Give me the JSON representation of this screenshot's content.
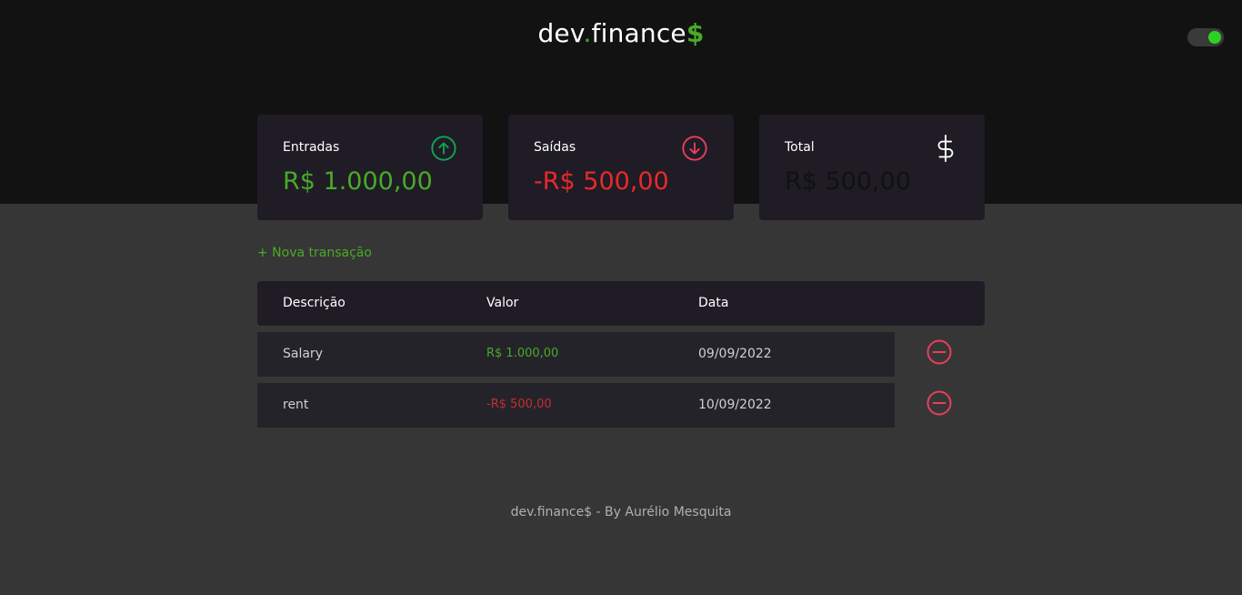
{
  "header": {
    "logo_main": "dev",
    "logo_dot": ".",
    "logo_word": "finance",
    "logo_dollar": "$",
    "theme_toggle_on": true
  },
  "cards": {
    "income": {
      "label": "Entradas",
      "value": "R$ 1.000,00",
      "icon": "arrow-up-circle-icon"
    },
    "expense": {
      "label": "Saídas",
      "value": "-R$ 500,00",
      "icon": "arrow-down-circle-icon"
    },
    "total": {
      "label": "Total",
      "value": "R$ 500,00",
      "icon": "dollar-sign-icon"
    }
  },
  "actions": {
    "new_transaction": "+ Nova transação"
  },
  "table": {
    "headers": {
      "description": "Descrição",
      "amount": "Valor",
      "date": "Data"
    },
    "rows": [
      {
        "description": "Salary",
        "amount": "R$ 1.000,00",
        "date": "09/09/2022",
        "type": "income"
      },
      {
        "description": "rent",
        "amount": "-R$ 500,00",
        "date": "10/09/2022",
        "type": "expense"
      }
    ]
  },
  "footer": {
    "text": "dev.finance$ - By Aurélio Mesquita"
  },
  "colors": {
    "accent_green": "#49aa26",
    "expense_red": "#e92929",
    "header_bg": "#121212",
    "body_bg": "#363636",
    "card_bg": "#1f1c26"
  }
}
